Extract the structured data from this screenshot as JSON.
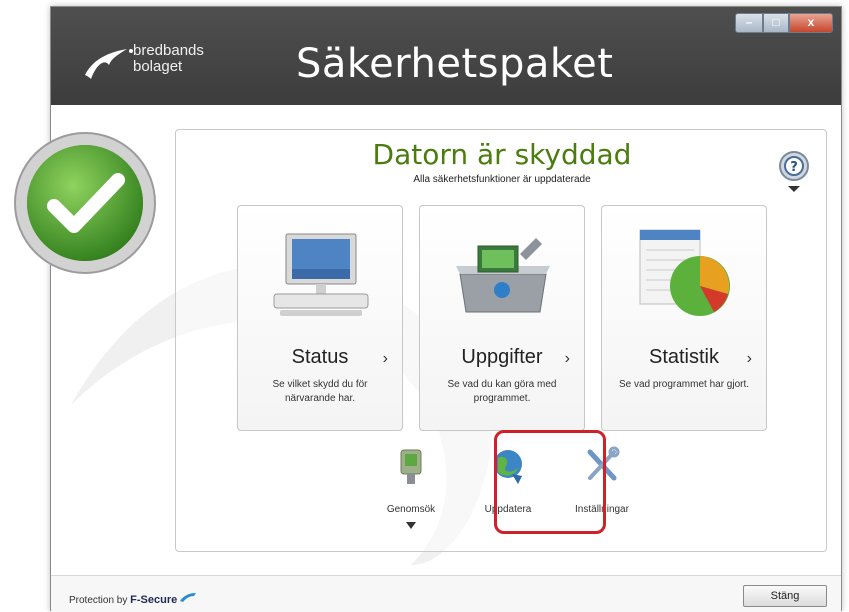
{
  "window": {
    "title": "Säkerhetspaket",
    "brand_line1": "bredbands",
    "brand_line2": "bolaget",
    "controls": {
      "minimize": "minimize-icon",
      "maximize": "maximize-icon",
      "close": "close-icon"
    }
  },
  "status": {
    "title": "Datorn är skyddad",
    "subtitle": "Alla säkerhetsfunktioner är uppdaterade",
    "icon": "checkmark-icon",
    "accent_color": "#4a7c0e"
  },
  "help": {
    "icon": "help-icon",
    "label": "?"
  },
  "tiles": [
    {
      "title": "Status",
      "arrow": "›",
      "desc": "Se vilket skydd du för närvarande har.",
      "icon": "computer-monitor-icon"
    },
    {
      "title": "Uppgifter",
      "arrow": "›",
      "desc": "Se vad du kan göra med programmet.",
      "icon": "toolbox-icon"
    },
    {
      "title": "Statistik",
      "arrow": "›",
      "desc": "Se vad programmet har gjort.",
      "icon": "pie-chart-icon"
    }
  ],
  "tools": [
    {
      "label": "Genomsök",
      "icon": "scanner-icon"
    },
    {
      "label": "Uppdatera",
      "icon": "globe-update-icon"
    },
    {
      "label": "Inställningar",
      "icon": "wrench-screwdriver-icon"
    }
  ],
  "footer": {
    "protection_prefix": "Protection by",
    "protection_brand": "F-Secure",
    "close_label": "Stäng"
  },
  "colors": {
    "highlight": "#d0202a",
    "titlebar": "#444444"
  }
}
